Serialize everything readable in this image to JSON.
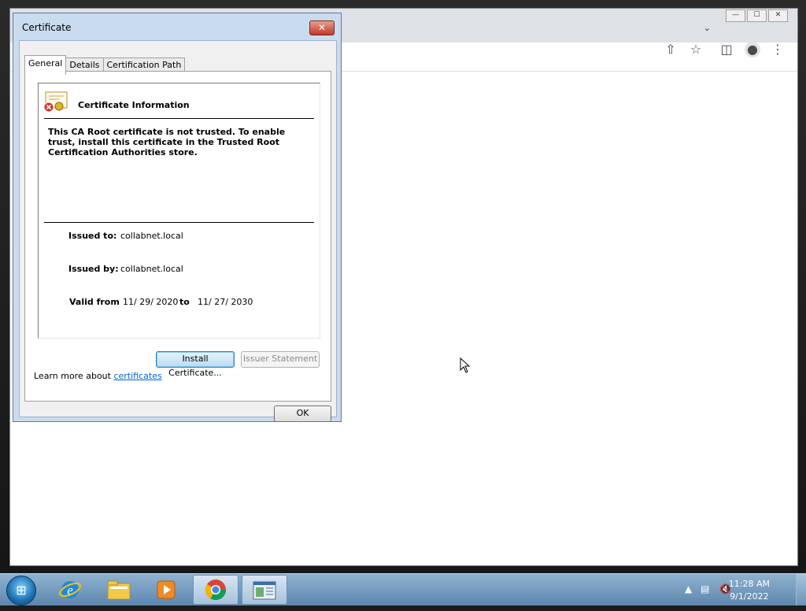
{
  "dialog": {
    "title": "Certificate",
    "close_label": "✕",
    "tabs": [
      {
        "label": "General"
      },
      {
        "label": "Details"
      },
      {
        "label": "Certification Path"
      }
    ],
    "info_heading": "Certificate Information",
    "trust_message": "This CA Root certificate is not trusted. To enable trust, install this certificate in the Trusted Root Certification Authorities store.",
    "issued_to_label": "Issued to:",
    "issued_to_value": "collabnet.local",
    "issued_by_label": "Issued by:",
    "issued_by_value": "collabnet.local",
    "valid_from_label": "Valid from",
    "valid_from_value": "11/ 29/ 2020",
    "valid_to_label": "to",
    "valid_to_value": "11/ 27/ 2030",
    "install_button": "Install Certificate...",
    "issuer_statement_button": "Issuer Statement",
    "learn_more_text": "Learn more about ",
    "learn_more_link": "certificates",
    "ok_button": "OK"
  },
  "browser": {
    "window_controls": {
      "minimize": "—",
      "maximize": "☐",
      "close": "✕"
    },
    "tab_search_icon": "chevron-down-icon",
    "toolbar_icons": [
      "share-icon",
      "bookmark-star-icon",
      "side-panel-icon",
      "profile-icon",
      "menu-icon"
    ]
  },
  "taskbar": {
    "apps": [
      "start-orb",
      "internet-explorer-icon",
      "file-explorer-icon",
      "media-player-icon",
      "chrome-icon",
      "certificate-manager-icon"
    ],
    "time": "11:28 AM",
    "date": "9/1/2022"
  },
  "colors": {
    "link": "#0066cc",
    "dialog_frame": "#c9dbee",
    "taskbar": "#6f97bd"
  }
}
